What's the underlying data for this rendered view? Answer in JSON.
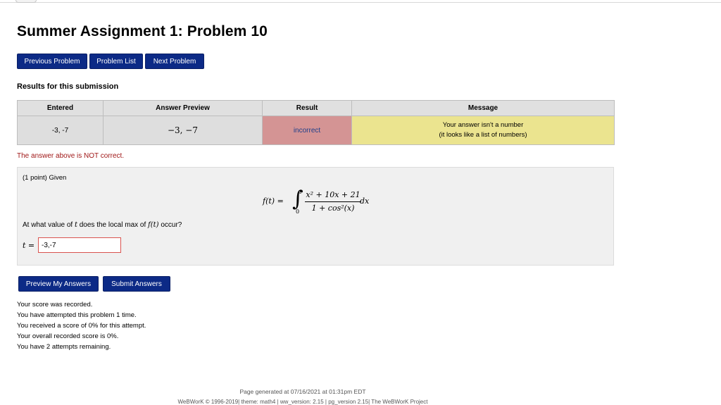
{
  "page": {
    "title": "Summer Assignment 1: Problem 10"
  },
  "nav": {
    "previous": "Previous Problem",
    "list": "Problem List",
    "next": "Next Problem"
  },
  "results": {
    "heading": "Results for this submission",
    "columns": [
      "Entered",
      "Answer Preview",
      "Result",
      "Message"
    ],
    "row": {
      "entered": "-3, -7",
      "preview": "−3, −7",
      "result": "incorrect",
      "message_line1": "Your answer isn't a number",
      "message_line2": "(it looks like a list of numbers)"
    },
    "not_correct": "The answer above is NOT correct."
  },
  "problem": {
    "given": "(1 point) Given",
    "formula": {
      "lhs": "f(t) =",
      "integral": "∫",
      "upper": "t",
      "lower": "0",
      "numerator": "x² + 10x + 21",
      "denominator": "1 + cos²(x)",
      "dx": "dx"
    },
    "question_pre": "At what value of",
    "question_var": "t",
    "question_mid": "does the local max of",
    "question_func": "f(t)",
    "question_post": "occur?",
    "answer_label": "t =",
    "answer_value": "-3,-7"
  },
  "actions": {
    "preview": "Preview My Answers",
    "submit": "Submit Answers"
  },
  "status": [
    "Your score was recorded.",
    "You have attempted this problem 1 time.",
    "You received a score of 0% for this attempt.",
    "Your overall recorded score is 0%.",
    "You have 2 attempts remaining."
  ],
  "footer": {
    "generated": "Page generated at 07/16/2021 at 01:31pm EDT",
    "copyright": "WeBWorK © 1996-2019| theme: math4 | ww_version: 2.15 | pg_version 2.15| The WeBWorK Project"
  },
  "colors": {
    "button": "#0c2a86",
    "incorrect_cell": "#d49494",
    "message_cell": "#ebe48f",
    "error_text": "#a01818"
  }
}
